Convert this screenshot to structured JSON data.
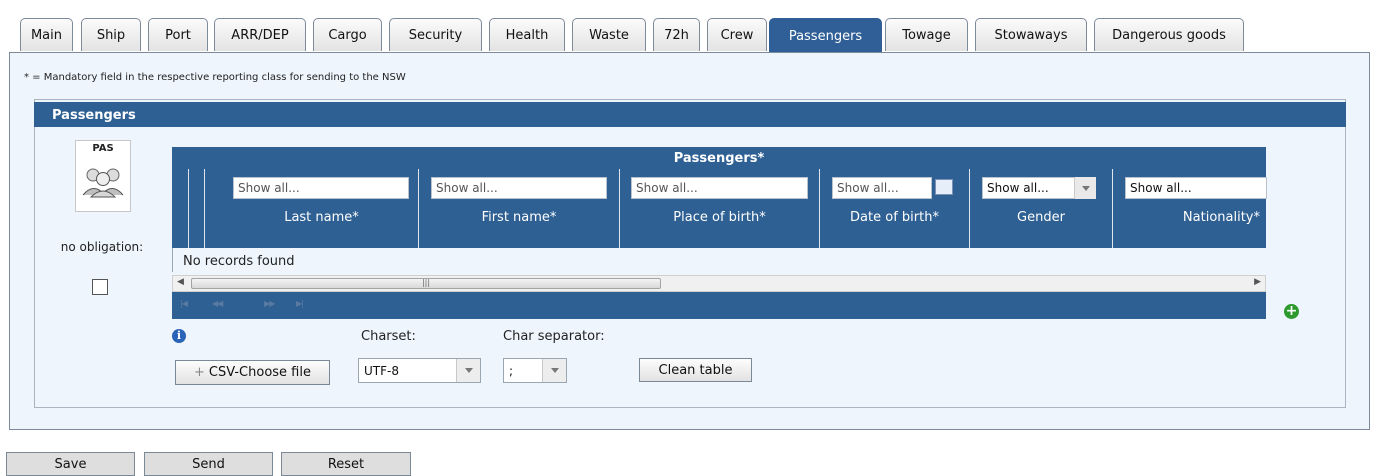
{
  "tabs": [
    "Main",
    "Ship",
    "Port",
    "ARR/DEP",
    "Cargo",
    "Security",
    "Health",
    "Waste",
    "72h",
    "Crew",
    "Passengers",
    "Towage",
    "Stowaways",
    "Dangerous goods"
  ],
  "active_tab": "Passengers",
  "mandatory_note": "* = Mandatory field in the respective reporting class for sending to the NSW",
  "section_title": "Passengers",
  "icon_label": "PAS",
  "no_obligation_label": "no obligation:",
  "grid": {
    "title": "Passengers*",
    "filter_placeholder": "Show all...",
    "columns": {
      "last_name": "Last name*",
      "first_name": "First name*",
      "place_of_birth": "Place of birth*",
      "date_of_birth": "Date of birth*",
      "gender": "Gender",
      "nationality": "Nationality*"
    },
    "gender_filter": "Show all...",
    "no_records": "No records found"
  },
  "import": {
    "charset_label": "Charset:",
    "charset_value": "UTF-8",
    "separator_label": "Char separator:",
    "separator_value": ";",
    "choose_file": "CSV-Choose file",
    "clean_table": "Clean table"
  },
  "footer": {
    "save": "Save",
    "send": "Send",
    "reset": "Reset"
  },
  "colors": {
    "header_blue": "#2e6093",
    "panel_bg": "#eef5fd"
  }
}
